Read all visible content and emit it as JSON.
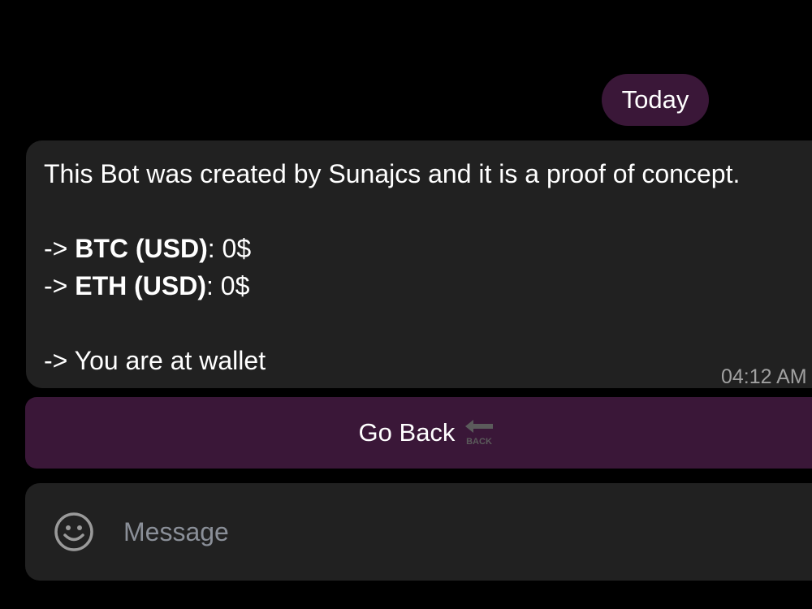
{
  "date_pill": {
    "label": "Today"
  },
  "message": {
    "line1": "This Bot was created by Sunajcs and it is a proof of concept.",
    "btc_prefix": "-> ",
    "btc_label": "BTC (USD)",
    "btc_value": ": 0$",
    "eth_prefix": "-> ",
    "eth_label": "ETH (USD)",
    "eth_value": ": 0$",
    "status": "-> You are at wallet",
    "time": "04:12 AM"
  },
  "keyboard": {
    "back_label": "Go Back",
    "back_icon_text": "BACK"
  },
  "composer": {
    "placeholder": "Message"
  },
  "colors": {
    "background": "#000000",
    "bubble": "#212121",
    "accent": "#3a1738",
    "muted_text": "#a0a0a0"
  }
}
